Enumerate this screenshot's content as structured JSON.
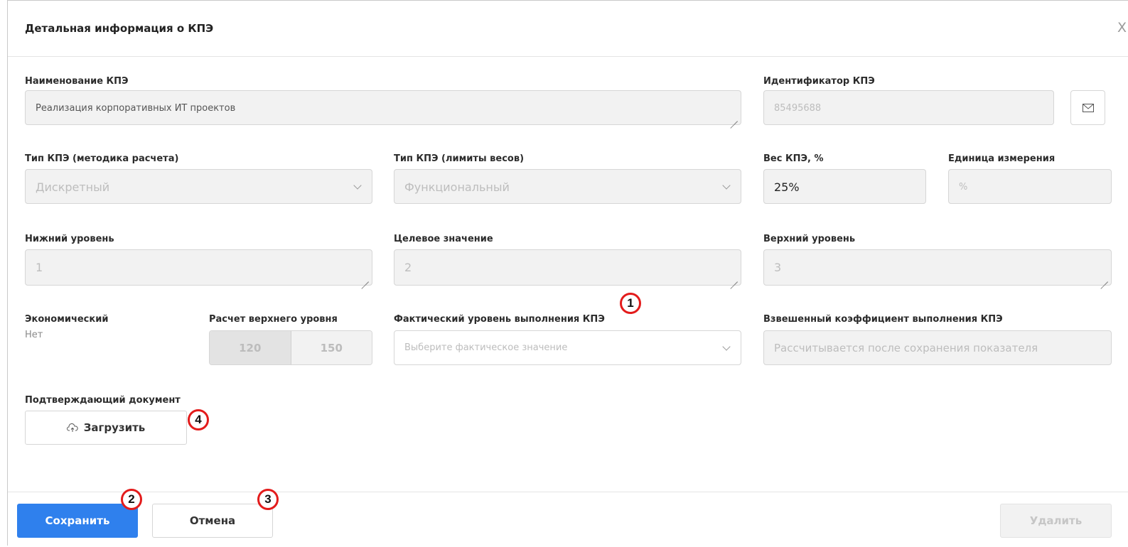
{
  "dialog": {
    "title": "Детальная информация о КПЭ",
    "close_glyph": "X"
  },
  "fields": {
    "name": {
      "label": "Наименование КПЭ",
      "value": "Реализация корпоративных ИТ проектов"
    },
    "identifier": {
      "label": "Идентификатор КПЭ",
      "value": "85495688"
    },
    "calc_type": {
      "label": "Тип КПЭ (методика расчета)",
      "value": "Дискретный"
    },
    "limit_type": {
      "label": "Тип КПЭ (лимиты весов)",
      "value": "Функциональный"
    },
    "weight": {
      "label": "Вес КПЭ, %",
      "value": "25%"
    },
    "unit": {
      "label": "Единица измерения",
      "value": "%"
    },
    "lower": {
      "label": "Нижний уровень",
      "value": "1"
    },
    "target": {
      "label": "Целевое значение",
      "value": "2"
    },
    "upper": {
      "label": "Верхний уровень",
      "value": "3"
    },
    "economic": {
      "label": "Экономический",
      "value": "Нет"
    },
    "upper_calc": {
      "label": "Расчет верхнего уровня",
      "options": [
        "120",
        "150"
      ]
    },
    "actual": {
      "label": "Фактический уровень выполнения КПЭ",
      "placeholder": "Выберите фактическое значение"
    },
    "weighted": {
      "label": "Взвешенный коэффициент выполнения КПЭ",
      "value": "Рассчитывается после сохранения показателя"
    },
    "document": {
      "label": "Подтверждающий документ",
      "upload_label": "Загрузить"
    }
  },
  "footer": {
    "save_label": "Сохранить",
    "cancel_label": "Отмена",
    "delete_label": "Удалить"
  },
  "annotations": [
    "1",
    "2",
    "3",
    "4"
  ],
  "icons": {
    "identifier_button": "envelope-icon",
    "upload": "cloud-upload-icon"
  },
  "colors": {
    "primary": "#2f80ed",
    "annotation": "#e31b1b",
    "field_bg": "#f2f2f2"
  }
}
